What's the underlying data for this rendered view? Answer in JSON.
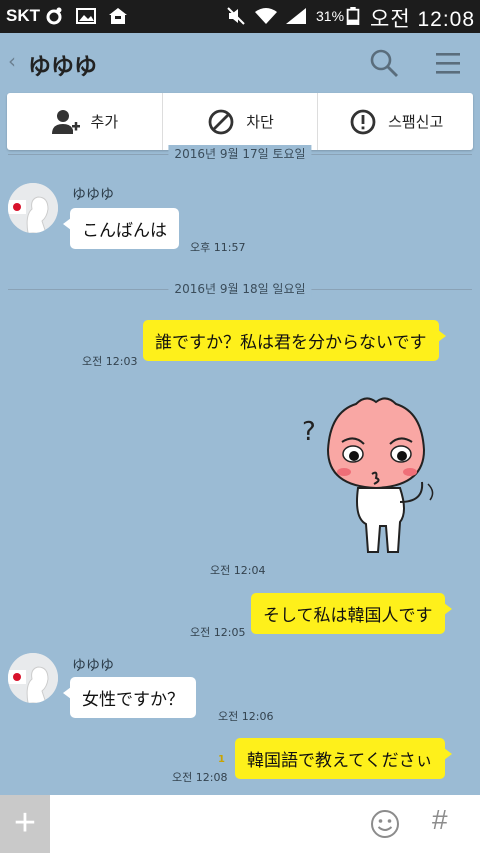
{
  "status_bar": {
    "carrier": "SKT",
    "battery_percent": "31%",
    "time": "오전 12:08"
  },
  "header": {
    "back_glyph": "‹",
    "title": "ゆゆゆ"
  },
  "actions": [
    {
      "label": "추가",
      "icon": "add-friend-icon"
    },
    {
      "label": "차단",
      "icon": "block-icon"
    },
    {
      "label": "스팸신고",
      "icon": "report-spam-icon"
    }
  ],
  "messages": {
    "date1": "2016년 9월 17일 토요일",
    "m1_sender": "ゆゆゆ",
    "m1_text": "こんばんは",
    "m1_time": "오후 11:57",
    "date2": "2016년 9월 18일 일요일",
    "m2_text": "誰ですか？私は君を分からないです",
    "m2_time": "오전 12:03",
    "m3_sticker": "peach-sticker",
    "m3_time": "오전 12:04",
    "m4_text": "そして私は韓国人です",
    "m4_time": "오전 12:05",
    "m5_sender": "ゆゆゆ",
    "m5_text": "女性ですか？",
    "m5_time": "오전 12:06",
    "m6_unread": "1",
    "m6_text": "韓国語で教えてくださぃ",
    "m6_time": "오전 12:08"
  },
  "input_bar": {
    "plus_label": "+",
    "hash_label": "#",
    "placeholder": ""
  },
  "colors": {
    "chat_bg": "#9bbbd4",
    "out_bubble": "#fef01b",
    "in_bubble": "#ffffff",
    "status_bg": "#1c1c1c"
  }
}
